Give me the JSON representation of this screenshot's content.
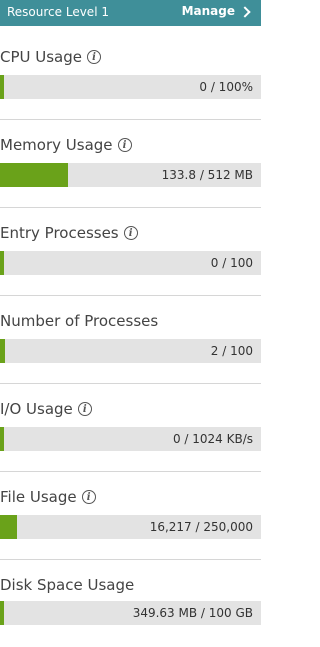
{
  "header": {
    "title": "Resource Level 1",
    "manage_label": "Manage"
  },
  "colors": {
    "header_bg": "#3f8f99",
    "bar_fill": "#6aa21a",
    "bar_track": "#e3e3e3"
  },
  "metrics": [
    {
      "label": "CPU Usage",
      "value": "0 / 100%",
      "fill_fraction": 0.0,
      "has_info": true
    },
    {
      "label": "Memory Usage",
      "value": "133.8 / 512 MB",
      "fill_fraction": 0.2613,
      "has_info": true
    },
    {
      "label": "Entry Processes",
      "value": "0 / 100",
      "fill_fraction": 0.0,
      "has_info": true
    },
    {
      "label": "Number of Processes",
      "value": "2 / 100",
      "fill_fraction": 0.02,
      "has_info": false
    },
    {
      "label": "I/O Usage",
      "value": "0 / 1024 KB/s",
      "fill_fraction": 0.0,
      "has_info": true
    },
    {
      "label": "File Usage",
      "value": "16,217 / 250,000",
      "fill_fraction": 0.0649,
      "has_info": true
    },
    {
      "label": "Disk Space Usage",
      "value": "349.63 MB / 100 GB",
      "fill_fraction": 0.0034,
      "has_info": false
    }
  ]
}
